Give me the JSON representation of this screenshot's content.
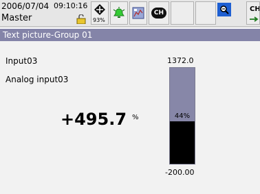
{
  "status": {
    "date": "2006/07/04",
    "time": "09:10:16",
    "user": "Master",
    "memory_percent": "93%",
    "ch_label": "CH",
    "edge_label": "CH"
  },
  "panel": {
    "title": "Text picture-Group 01",
    "tag": "Input03",
    "description": "Analog input03",
    "value": "+495.7",
    "unit": "%",
    "bar": {
      "scale_max": "1372.0",
      "scale_min": "-200.00",
      "fill_percent": 44,
      "fill_label": "44%"
    }
  },
  "colors": {
    "title_bar": "#8484a8",
    "bar_background": "#8787a8",
    "bar_fill": "#000000",
    "zoom_button": "#1e5fd2"
  }
}
